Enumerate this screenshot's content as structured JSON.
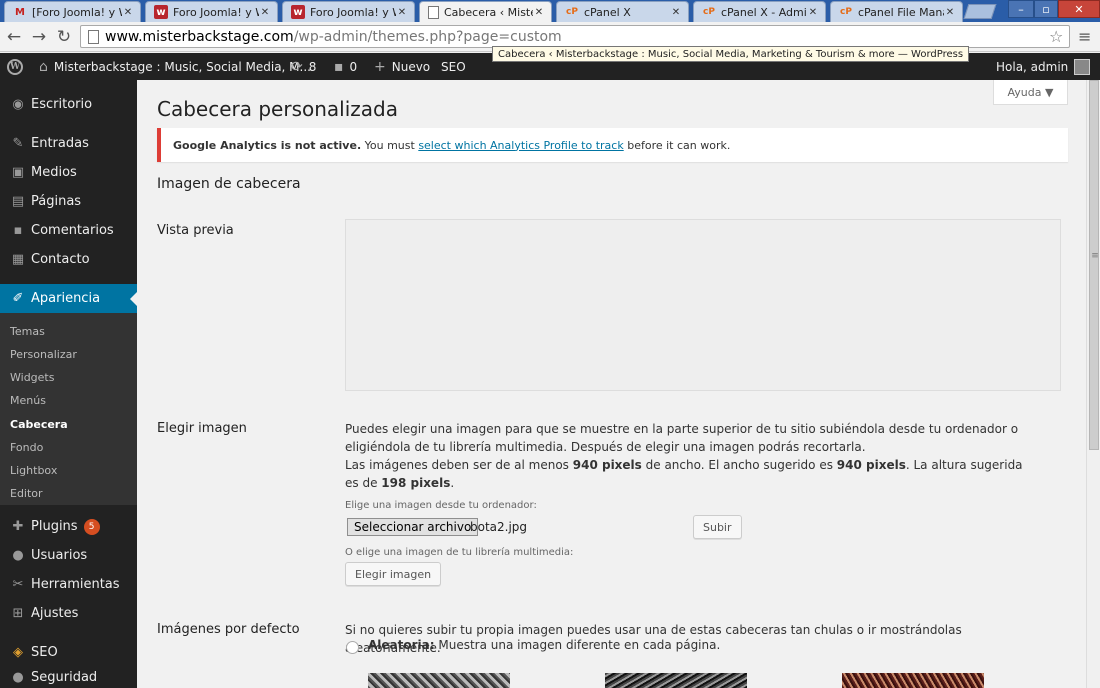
{
  "browser": {
    "tabs": [
      {
        "title": "[Foro Joomla! y Wo",
        "icon": "gmail-icon"
      },
      {
        "title": "Foro Joomla! y Wor",
        "icon": "w-icon"
      },
      {
        "title": "Foro Joomla! y Wor",
        "icon": "w-icon"
      },
      {
        "title": "Cabecera ‹ Misterba",
        "icon": "page-icon"
      },
      {
        "title": "cPanel X",
        "icon": "cpanel-icon"
      },
      {
        "title": "cPanel X - Administ",
        "icon": "cpanel-icon"
      },
      {
        "title": "cPanel File Manage",
        "icon": "cpanel-icon"
      }
    ],
    "url_host": "www.misterbackstage.com",
    "url_path": "/wp-admin/themes.php?page=custom",
    "tooltip": "Cabecera ‹ Misterbackstage : Music, Social Media, Marketing & Tourism & more — WordPress"
  },
  "adminbar": {
    "site_name": "Misterbackstage : Music, Social Media, M...",
    "updates_count": "8",
    "comments_count": "0",
    "new_label": "Nuevo",
    "seo_label": "SEO",
    "greeting": "Hola, admin"
  },
  "sidebar": {
    "items": [
      {
        "label": "Escritorio",
        "icon": "dashboard-icon"
      },
      {
        "label": "Entradas",
        "icon": "pin-icon"
      },
      {
        "label": "Medios",
        "icon": "media-icon"
      },
      {
        "label": "Páginas",
        "icon": "pages-icon"
      },
      {
        "label": "Comentarios",
        "icon": "comment-icon"
      },
      {
        "label": "Contacto",
        "icon": "contact-icon"
      },
      {
        "label": "Apariencia",
        "icon": "brush-icon"
      },
      {
        "label": "Plugins",
        "icon": "plugin-icon"
      },
      {
        "label": "Usuarios",
        "icon": "user-icon"
      },
      {
        "label": "Herramientas",
        "icon": "wrench-icon"
      },
      {
        "label": "Ajustes",
        "icon": "settings-icon"
      },
      {
        "label": "SEO",
        "icon": "seo-icon"
      },
      {
        "label": "Seguridad",
        "icon": "lock-icon"
      }
    ],
    "submenu": [
      "Temas",
      "Personalizar",
      "Widgets",
      "Menús",
      "Cabecera",
      "Fondo",
      "Lightbox",
      "Editor"
    ],
    "plugins_badge": "5"
  },
  "main": {
    "help_label": "Ayuda",
    "page_title": "Cabecera personalizada",
    "notice": {
      "bold": "Google Analytics is not active.",
      "before_link": " You must ",
      "link": "select which Analytics Profile to track",
      "after_link": " before it can work."
    },
    "section_title": "Imagen de cabecera",
    "preview_label": "Vista previa",
    "choose_label": "Elegir imagen",
    "choose_desc_1": "Puedes elegir una imagen para que se muestre en la parte superior de tu sitio subiéndola desde tu ordenador o eligiéndola de tu librería multimedia. Después de elegir una imagen podrás recortarla.",
    "choose_desc_2a": "Las imágenes deben ser de al menos ",
    "choose_desc_2b": "940 pixels",
    "choose_desc_2c": " de ancho. El ancho sugerido es ",
    "choose_desc_2d": "940 pixels",
    "choose_desc_2e": ". La altura sugerida es de ",
    "choose_desc_2f": "198 pixels",
    "choose_desc_2g": ".",
    "upload_label": "Elige una imagen desde tu ordenador:",
    "file_button": "Seleccionar archivo",
    "file_name": "bota2.jpg",
    "upload_button": "Subir",
    "library_label": "O elige una imagen de tu librería multimedia:",
    "library_button": "Elegir imagen",
    "defaults_label": "Imágenes por defecto",
    "defaults_desc": "Si no quieres subir tu propia imagen puedes usar una de estas cabeceras tan chulas o ir mostrándolas aleatoriamente.",
    "random_bold": "Aleatoria:",
    "random_text": " Muestra una imagen diferente en cada página."
  }
}
